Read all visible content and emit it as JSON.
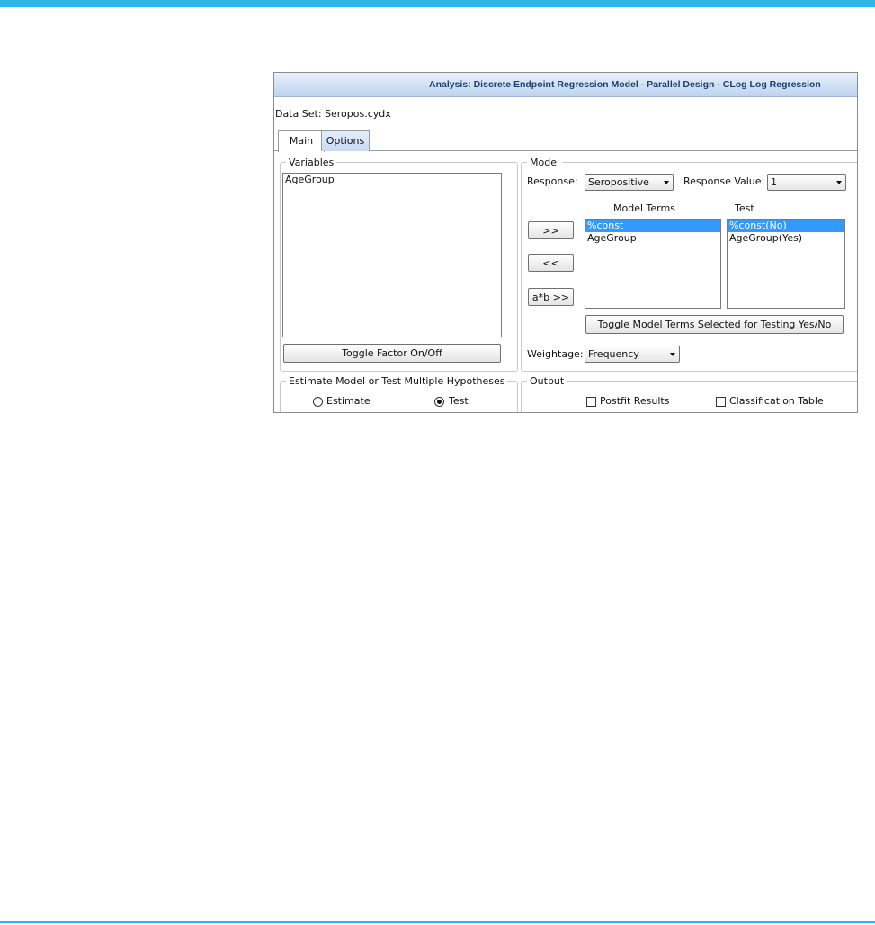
{
  "window": {
    "title": "Analysis: Discrete Endpoint Regression Model - Parallel Design - CLog Log Regression",
    "dataset_label": "Data Set: Seropos.cydx"
  },
  "tabs": [
    {
      "label": "Main",
      "active": true
    },
    {
      "label": "Options",
      "active": false
    }
  ],
  "variables": {
    "legend": "Variables",
    "items": [
      "AgeGroup"
    ],
    "toggle_button": "Toggle Factor On/Off"
  },
  "model": {
    "legend": "Model",
    "response_label": "Response:",
    "response_value": "Seropositive",
    "response_value_label": "Response Value:",
    "response_value_value": "1",
    "model_terms_header": "Model Terms",
    "model_terms": [
      {
        "text": "%const",
        "selected": true
      },
      {
        "text": "AgeGroup",
        "selected": false
      }
    ],
    "test_header": "Test",
    "test_terms": [
      {
        "text": "%const(No)",
        "selected": true
      },
      {
        "text": "AgeGroup(Yes)",
        "selected": false
      }
    ],
    "add_button": ">>",
    "remove_button": "<<",
    "interaction_button": "a*b >>",
    "toggle_test_button": "Toggle Model Terms Selected for Testing Yes/No",
    "weightage_label": "Weightage:",
    "weightage_value": "Frequency"
  },
  "estimate": {
    "legend": "Estimate Model or Test Multiple Hypotheses",
    "options": [
      {
        "label": "Estimate",
        "selected": false
      },
      {
        "label": "Test",
        "selected": true
      }
    ]
  },
  "output": {
    "legend": "Output",
    "options": [
      {
        "label": "Postfit Results",
        "checked": false
      },
      {
        "label": "Classification Table",
        "checked": false
      }
    ]
  },
  "colors": {
    "accent_bar": "#2eb6e9",
    "selection": "#3399ff",
    "title_text": "#1e3f73"
  }
}
